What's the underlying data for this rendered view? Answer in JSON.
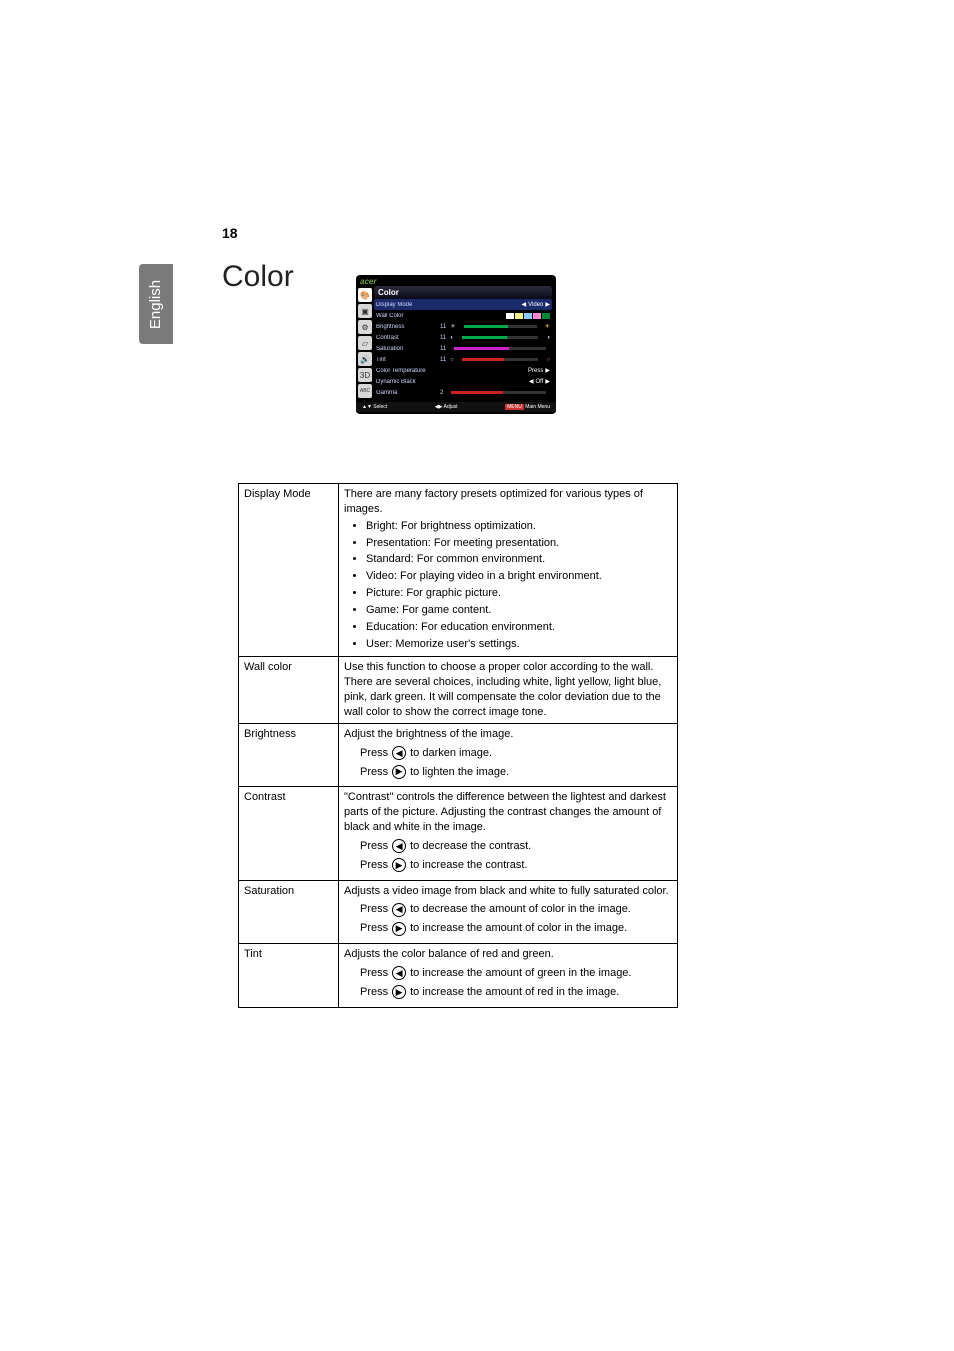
{
  "page_number": "18",
  "language_tab": "English",
  "heading": "Color",
  "osd": {
    "brand": "acer",
    "title": "Color",
    "rows": {
      "display_mode": {
        "label": "Display Mode",
        "value": "Video"
      },
      "wall_color": {
        "label": "Wall Color"
      },
      "brightness": {
        "label": "Brightness",
        "num": "11"
      },
      "contrast": {
        "label": "Contrast",
        "num": "11"
      },
      "saturation": {
        "label": "Saturation",
        "num": "11"
      },
      "tint": {
        "label": "Tint",
        "num": "11"
      },
      "color_temp": {
        "label": "Color Temperature",
        "value": "Press"
      },
      "dyn_black": {
        "label": "Dynamic Black",
        "value": "Off"
      },
      "gamma": {
        "label": "Gamma",
        "num": "2"
      }
    },
    "footer": {
      "select": "Select",
      "adjust": "Adjust",
      "menu": "MENU",
      "main": "Main Menu"
    }
  },
  "icons": {
    "left": "◀",
    "right": "▶",
    "up": "▲",
    "down": "▼",
    "lr": "◀▶"
  },
  "table": {
    "display_mode": {
      "label": "Display Mode",
      "intro": "There are many factory presets optimized for various types of images.",
      "items": {
        "bright": "Bright: For brightness optimization.",
        "presentation": "Presentation: For meeting presentation.",
        "standard": "Standard: For common environment.",
        "video": "Video: For playing video in a bright environment.",
        "picture": "Picture: For graphic picture.",
        "game": "Game: For game content.",
        "education": "Education: For education environment.",
        "user": "User: Memorize user's settings."
      }
    },
    "wall_color": {
      "label": "Wall color",
      "text": "Use this function to choose a proper color according to the wall. There are several choices, including white, light yellow, light blue, pink, dark green. It will compensate the color deviation due to the wall color to show the correct image tone."
    },
    "brightness": {
      "label": "Brightness",
      "intro": "Adjust the brightness of the image.",
      "press_word": "Press",
      "left": "to darken image.",
      "right": "to lighten the image."
    },
    "contrast": {
      "label": "Contrast",
      "intro": "\"Contrast\" controls the difference between the lightest and darkest parts of the picture. Adjusting the contrast changes the amount of black and white in the image.",
      "press_word": "Press",
      "left": "to decrease the contrast.",
      "right": "to increase the contrast."
    },
    "saturation": {
      "label": "Saturation",
      "intro": "Adjusts a video image from black and white to fully saturated color.",
      "press_word": "Press",
      "left": "to decrease the amount of color in the image.",
      "right": "to increase the amount of color in the image."
    },
    "tint": {
      "label": "Tint",
      "intro": "Adjusts the color balance of red and green.",
      "press_word": "Press",
      "left": "to increase the amount of green in the image.",
      "right": "to increase the amount of red in the image."
    }
  }
}
